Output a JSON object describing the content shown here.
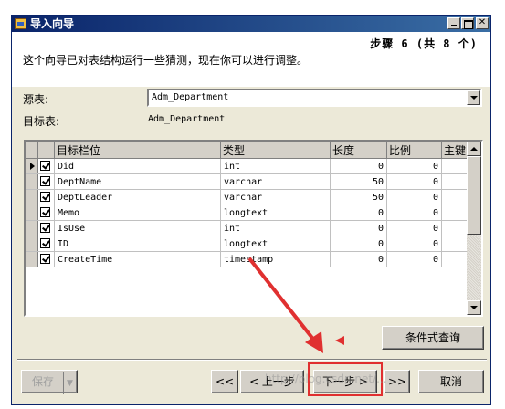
{
  "window": {
    "title": "导入向导",
    "step": "步骤 6 (共 8 个)",
    "description": "这个向导已对表结构运行一些猜测，现在你可以进行调整。"
  },
  "source": {
    "label": "源表:",
    "value": "Adm_Department"
  },
  "target": {
    "label": "目标表:",
    "value": "Adm_Department"
  },
  "grid": {
    "columns": [
      "目标栏位",
      "类型",
      "长度",
      "比例",
      "主键"
    ],
    "rows": [
      {
        "field": "Did",
        "type": "int",
        "length": "0",
        "scale": "0",
        "checked": true,
        "current": true
      },
      {
        "field": "DeptName",
        "type": "varchar",
        "length": "50",
        "scale": "0",
        "checked": true
      },
      {
        "field": "DeptLeader",
        "type": "varchar",
        "length": "50",
        "scale": "0",
        "checked": true
      },
      {
        "field": "Memo",
        "type": "longtext",
        "length": "0",
        "scale": "0",
        "checked": true
      },
      {
        "field": "IsUse",
        "type": "int",
        "length": "0",
        "scale": "0",
        "checked": true
      },
      {
        "field": "ID",
        "type": "longtext",
        "length": "0",
        "scale": "0",
        "checked": true
      },
      {
        "field": "CreateTime",
        "type": "timestamp",
        "length": "0",
        "scale": "0",
        "checked": true
      }
    ]
  },
  "buttons": {
    "conditional_query": "条件式查询",
    "save": "保存",
    "first": "<<",
    "prev": "< 上一步",
    "next": "下一步 >",
    "last": ">>",
    "cancel": "取消"
  },
  "watermark": "http://blog.csdn.net/...",
  "colors": {
    "annotation": "#e03030",
    "titlebar": "#0a246a",
    "face": "#d4d0c8"
  }
}
